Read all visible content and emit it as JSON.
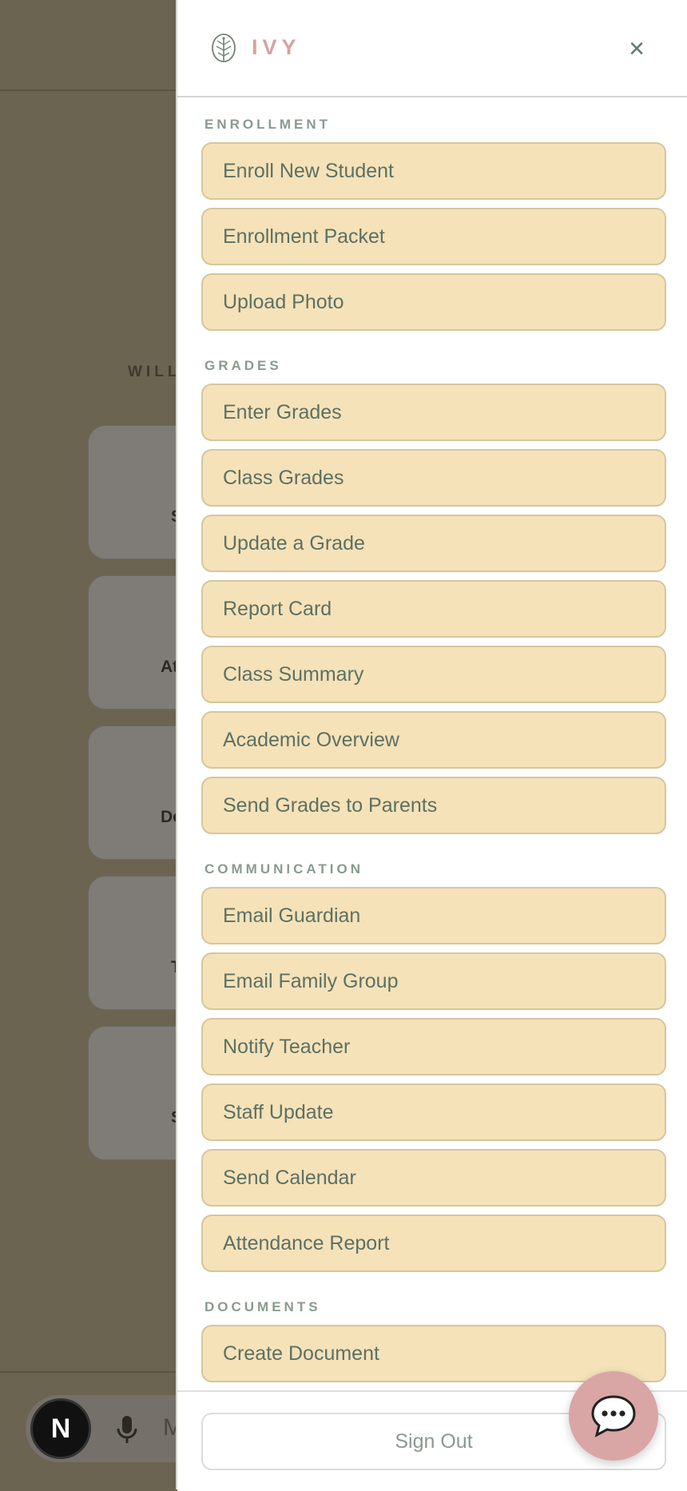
{
  "background": {
    "subtitle": "WILL",
    "cards": [
      "S",
      "At",
      "Do",
      "T",
      "S"
    ],
    "input_logo": "N",
    "input_placeholder": "M"
  },
  "drawer": {
    "brand": "IVY",
    "close_label": "×",
    "sections": [
      {
        "label": "ENROLLMENT",
        "items": [
          "Enroll New Student",
          "Enrollment Packet",
          "Upload Photo"
        ]
      },
      {
        "label": "GRADES",
        "items": [
          "Enter Grades",
          "Class Grades",
          "Update a Grade",
          "Report Card",
          "Class Summary",
          "Academic Overview",
          "Send Grades to Parents"
        ]
      },
      {
        "label": "COMMUNICATION",
        "items": [
          "Email Guardian",
          "Email Family Group",
          "Notify Teacher",
          "Staff Update",
          "Send Calendar",
          "Attendance Report"
        ]
      },
      {
        "label": "DOCUMENTS",
        "items": [
          "Create Document"
        ]
      }
    ],
    "sign_out": "Sign Out"
  },
  "colors": {
    "accent_pink": "#d9a6a5",
    "menu_bg": "#f5e2b8",
    "text_green": "#5c7064"
  },
  "icons": {
    "brand": "leaf-icon",
    "close": "close-icon",
    "chat": "chat-bubble-icon",
    "mic": "microphone-icon"
  }
}
